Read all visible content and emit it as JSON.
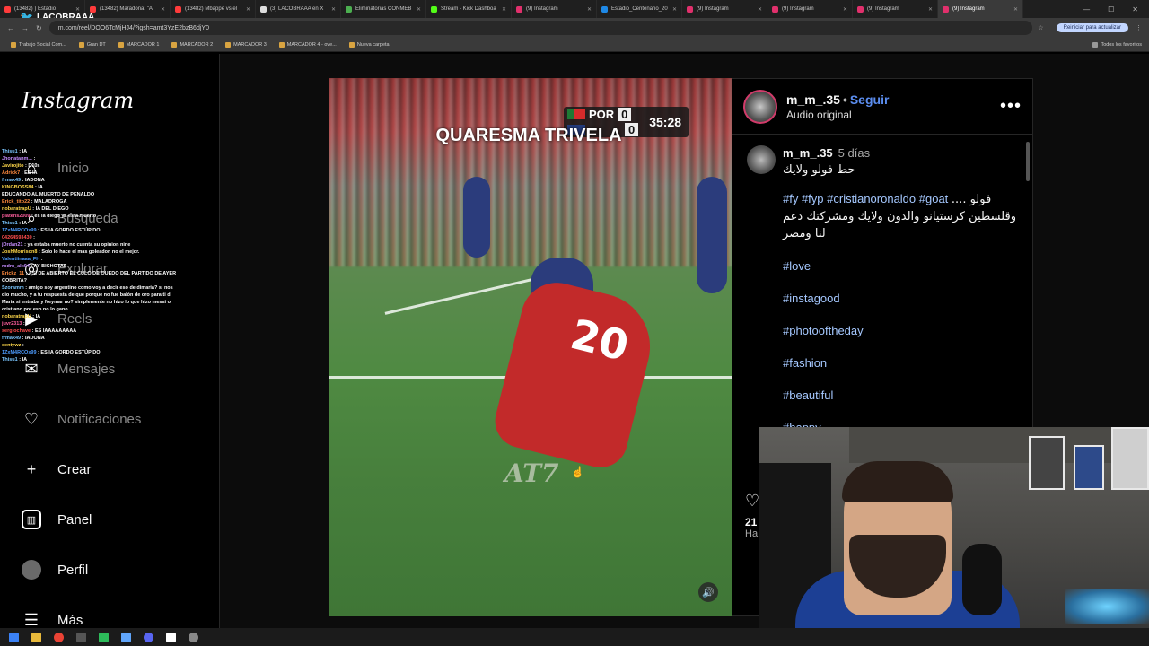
{
  "browser": {
    "tabs": [
      {
        "title": "(13482) ) Estadio",
        "color": "#ff3b3b",
        "active": false
      },
      {
        "title": "(13482) Maradona: \"A",
        "color": "#ff3b3b",
        "active": false
      },
      {
        "title": "(13482) Mbappe vs el",
        "color": "#ff3b3b",
        "active": false
      },
      {
        "title": "(3) LACOBRAAA en X",
        "color": "#dddddd",
        "active": false
      },
      {
        "title": "Eliminatorias CONMEB",
        "color": "#4caf50",
        "active": false
      },
      {
        "title": "Stream - Kick Dashboa",
        "color": "#53fc18",
        "active": false
      },
      {
        "title": "(9) Instagram",
        "color": "#e1306c",
        "active": false
      },
      {
        "title": "Estadio_Centenario_20",
        "color": "#1e88e5",
        "active": false
      },
      {
        "title": "(9) Instagram",
        "color": "#e1306c",
        "active": false
      },
      {
        "title": "(9) Instagram",
        "color": "#e1306c",
        "active": false
      },
      {
        "title": "(9) Instagram",
        "color": "#e1306c",
        "active": false
      },
      {
        "title": "(9) Instagram",
        "color": "#e1306c",
        "active": true
      }
    ],
    "url": "m.com/reel/DOO6TcMjHJ4/?igsh=amt3YzE2bzB6djY0",
    "update_button": "Reiniciar para actualizar",
    "bookmarks": [
      "Trabajo Social Com...",
      "Gran DT",
      "MARCADOR 1",
      "MARCADOR 2",
      "MARCADOR 3",
      "MARCADOR 4 - ove...",
      "Nueva carpeta"
    ],
    "all_bookmarks": "Todos los favoritos",
    "overlay_logo": "LACOBRAAA"
  },
  "sidebar": {
    "logo": "Instagram",
    "items": [
      {
        "label": "Inicio",
        "icon": "home-icon"
      },
      {
        "label": "Búsqueda",
        "icon": "search-icon"
      },
      {
        "label": "Explorar",
        "icon": "explore-icon"
      },
      {
        "label": "Reels",
        "icon": "reels-icon"
      },
      {
        "label": "Mensajes",
        "icon": "messages-icon"
      },
      {
        "label": "Notificaciones",
        "icon": "heart-icon"
      },
      {
        "label": "Crear",
        "icon": "plus-icon"
      },
      {
        "label": "Panel",
        "icon": "panel-icon"
      },
      {
        "label": "Perfil",
        "icon": "avatar"
      },
      {
        "label": "Más",
        "icon": "menu-icon"
      }
    ]
  },
  "chat": {
    "messages": [
      {
        "user": "Thisu1",
        "text": "IA",
        "color": "#7ac6ff"
      },
      {
        "user": "Jhonatanm...",
        "text": "",
        "color": "#c58cff"
      },
      {
        "user": "Javirojito",
        "text": "D10s",
        "color": "#ffd84a"
      },
      {
        "user": "Adrick7",
        "text": "ES IA",
        "color": "#ff8a3d"
      },
      {
        "user": "frmak49",
        "text": "IADONA",
        "color": "#7ac6ff"
      },
      {
        "user": "KINGBOSS84",
        "text": "IA",
        "color": "#ffd84a"
      },
      {
        "user": "",
        "text": "EDUCANDO AL MUERTO DE PENALDO",
        "color": "#ff4d4d"
      },
      {
        "user": "Erick_tito22",
        "text": "MALADROGA",
        "color": "#ff8a3d"
      },
      {
        "user": "nobaratrapU",
        "text": "IA DEL DIEGO",
        "color": "#ffd84a"
      },
      {
        "user": "platens2009",
        "text": "es ia diego ya esta muerto",
        "color": "#ff5f9e"
      },
      {
        "user": "Thisu1",
        "text": "IA",
        "color": "#7ac6ff"
      },
      {
        "user": "1ZxM4RCOx99",
        "text": "ES IA GORDO ESTÚPIDO",
        "color": "#4d9cff"
      },
      {
        "user": "04264593430",
        "text": "",
        "color": "#ff4d4d"
      },
      {
        "user": "jDrdan21",
        "text": "ya estaba muerto no cuenta su opinion nine",
        "color": "#c58cff"
      },
      {
        "user": "JoshMorrison8",
        "text": "Solo lo hace el mas goleador, no el mejor.",
        "color": "#ffd84a"
      },
      {
        "user": "Valentiinaaa_FH",
        "text": "",
        "color": "#4d9cff"
      },
      {
        "user": "rodrx_alx04",
        "text": "AY BICHOTAS",
        "color": "#c58cff"
      },
      {
        "user": "Erickz_11",
        "text": "ASÍ DE ABIERTO EL CULO DE QUEDO DEL PARTIDO DE AYER COBRITA?",
        "color": "#ff8a3d"
      },
      {
        "user": "Szoramm",
        "text": "amigo soy argentino como voy a decir eso de dimaria? si nos dio mucho, y a tu respuesta de que porque no fue balón de oro para ti di Maria si entraba y Neymar no? simplemente no hizo lo que hizo messi o cristiano por eso no lo gano",
        "color": "#7ac6ff"
      },
      {
        "user": "nobaratrapU",
        "text": "IA",
        "color": "#ffd84a"
      },
      {
        "user": "juvr2313",
        "text": "",
        "color": "#ff5f9e"
      },
      {
        "user": "sergiochave",
        "text": "ES IAAAAAAAAA",
        "color": "#ff4d4d"
      },
      {
        "user": "frmak49",
        "text": "IADONA",
        "color": "#7ac6ff"
      },
      {
        "user": "sentywz",
        "text": "",
        "color": "#ffd84a"
      },
      {
        "user": "1ZxM4RCOx99",
        "text": "ES IA GORDO ESTÚPIDO",
        "color": "#4d9cff"
      },
      {
        "user": "Thisu1",
        "text": "IA",
        "color": "#7ac6ff"
      }
    ]
  },
  "video": {
    "caption": "QUARESMA TRIVELA",
    "score_team": "POR",
    "score_home": "0",
    "score_away": "0",
    "clock": "35:28",
    "watermark": "AT7",
    "jersey": "20",
    "mute_icon": "speaker-icon"
  },
  "post": {
    "username": "m_m_.35",
    "follow": "Seguir",
    "audio": "Audio original",
    "comment_user": "m_m_.35",
    "comment_date": "5 días",
    "comment_line1": "حط فولو ولايك",
    "hashtags_inline": "#fy #fyp #cristianoronaldo #goat",
    "arabic_tail": ".... فولو وقلسطين كرستيانو والدون ولايك ومشركتك دعم لنا ومصر",
    "tags": [
      "#love",
      "#instagood",
      "#photooftheday",
      "#fashion",
      "#beautiful",
      "#happy"
    ],
    "likes_partial": "21",
    "time_partial": "Ha"
  }
}
